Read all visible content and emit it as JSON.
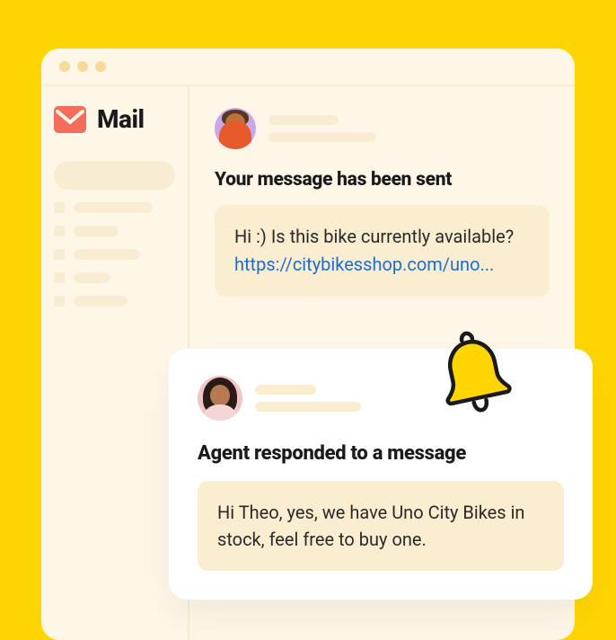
{
  "sidebar": {
    "brand_label": "Mail"
  },
  "message": {
    "heading": "Your message has been sent",
    "body_text": "Hi :) Is this bike currently available?",
    "body_link": "https://citybikesshop.com/uno..."
  },
  "notification": {
    "heading": "Agent responded to a message",
    "body": "Hi Theo, yes, we have Uno City Bikes in stock, feel free to buy one."
  }
}
